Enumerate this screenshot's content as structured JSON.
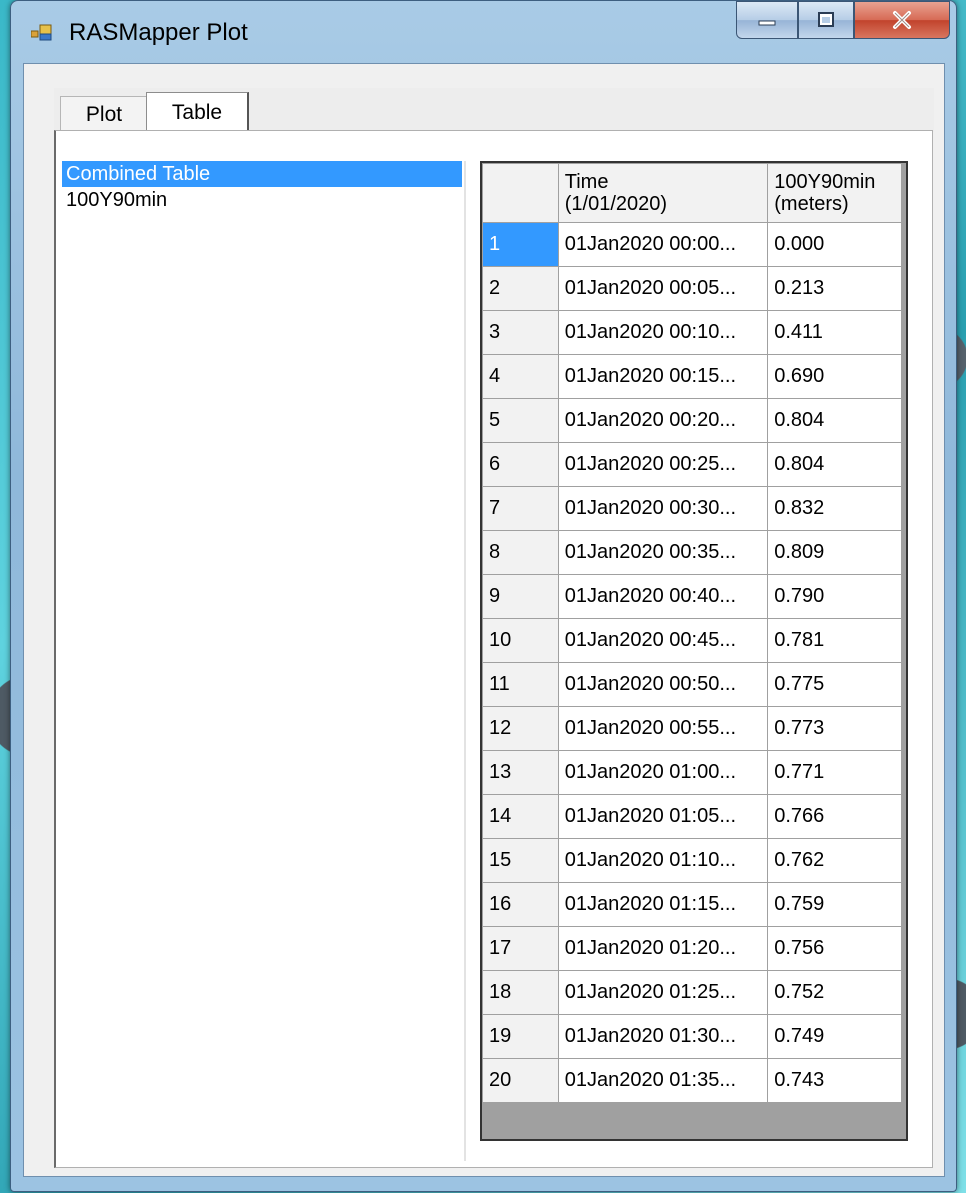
{
  "window": {
    "title": "RASMapper Plot"
  },
  "tabs": [
    {
      "label": "Plot",
      "active": false
    },
    {
      "label": "Table",
      "active": true
    }
  ],
  "list": {
    "items": [
      {
        "label": "Combined Table",
        "selected": true
      },
      {
        "label": "100Y90min",
        "selected": false
      }
    ]
  },
  "table": {
    "headers": [
      {
        "line1": "",
        "line2": ""
      },
      {
        "line1": "Time",
        "line2": "(1/01/2020)"
      },
      {
        "line1": "100Y90min",
        "line2": "(meters)"
      }
    ],
    "rows": [
      [
        "1",
        "01Jan2020 00:00...",
        "0.000"
      ],
      [
        "2",
        "01Jan2020 00:05...",
        "0.213"
      ],
      [
        "3",
        "01Jan2020 00:10...",
        "0.411"
      ],
      [
        "4",
        "01Jan2020 00:15...",
        "0.690"
      ],
      [
        "5",
        "01Jan2020 00:20...",
        "0.804"
      ],
      [
        "6",
        "01Jan2020 00:25...",
        "0.804"
      ],
      [
        "7",
        "01Jan2020 00:30...",
        "0.832"
      ],
      [
        "8",
        "01Jan2020 00:35...",
        "0.809"
      ],
      [
        "9",
        "01Jan2020 00:40...",
        "0.790"
      ],
      [
        "10",
        "01Jan2020 00:45...",
        "0.781"
      ],
      [
        "11",
        "01Jan2020 00:50...",
        "0.775"
      ],
      [
        "12",
        "01Jan2020 00:55...",
        "0.773"
      ],
      [
        "13",
        "01Jan2020 01:00...",
        "0.771"
      ],
      [
        "14",
        "01Jan2020 01:05...",
        "0.766"
      ],
      [
        "15",
        "01Jan2020 01:10...",
        "0.762"
      ],
      [
        "16",
        "01Jan2020 01:15...",
        "0.759"
      ],
      [
        "17",
        "01Jan2020 01:20...",
        "0.756"
      ],
      [
        "18",
        "01Jan2020 01:25...",
        "0.752"
      ],
      [
        "19",
        "01Jan2020 01:30...",
        "0.749"
      ],
      [
        "20",
        "01Jan2020 01:35...",
        "0.743"
      ]
    ],
    "current_row": 0
  },
  "icons": {
    "app": "rasmapper-app-icon",
    "minimize": "minimize-icon",
    "maximize": "maximize-icon",
    "close": "close-icon"
  },
  "colors": {
    "selection": "#3399ff",
    "close_button": "#c1432c"
  }
}
